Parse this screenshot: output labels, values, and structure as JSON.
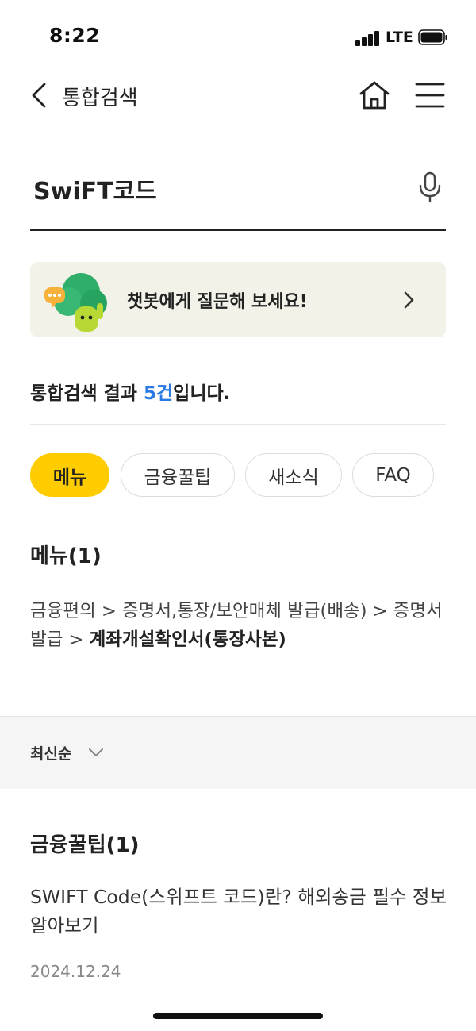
{
  "status_bar": {
    "time": "8:22",
    "network": "LTE",
    "icons": [
      "signal-icon",
      "battery-icon"
    ]
  },
  "nav": {
    "title": "통합검색",
    "icons": [
      "back-arrow-icon",
      "home-icon",
      "hamburger-menu-icon"
    ]
  },
  "search": {
    "query": "SwiFT코드",
    "icon": "microphone-icon"
  },
  "chatbot": {
    "text": "챗봇에게 질문해 보세요!",
    "icon": "chatbot-character-icon"
  },
  "results": {
    "prefix": "통합검색 결과 ",
    "count": "5건",
    "suffix": "입니다.",
    "accent_color": "#2a7ae2"
  },
  "tabs": [
    {
      "label": "메뉴",
      "active": true
    },
    {
      "label": "금융꿀팁",
      "active": false
    },
    {
      "label": "새소식",
      "active": false
    },
    {
      "label": "FAQ",
      "active": false
    }
  ],
  "menu_section": {
    "title": "메뉴(1)",
    "path_text": "금융편의 > 증명서,통장/보안매체 발급(배송) > 증명서 발급 > ",
    "path_bold": "계좌개설확인서(통장사본)"
  },
  "sort": {
    "label": "최신순"
  },
  "tips_section": {
    "title": "금융꿀팁(1)",
    "item_title": "SWIFT Code(스위프트 코드)란? 해외송금 필수 정보 알아보기",
    "item_date": "2024.12.24"
  },
  "colors": {
    "active_tab": "#ffcc00",
    "banner_bg": "#f3f2e9",
    "sort_bar_bg": "#f5f5f5"
  }
}
